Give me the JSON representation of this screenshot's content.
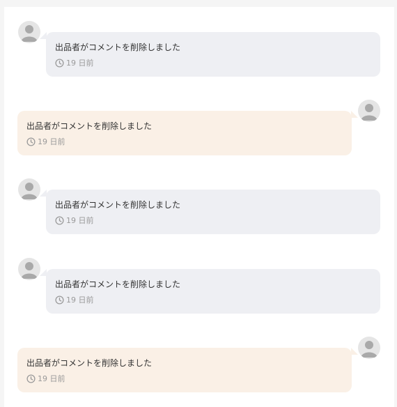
{
  "comments": [
    {
      "side": "left",
      "text": "出品者がコメントを削除しました",
      "time": "19 日前",
      "avatar_icon": "user-avatar-icon"
    },
    {
      "side": "right",
      "text": "出品者がコメントを削除しました",
      "time": "19 日前",
      "avatar_icon": "user-avatar-icon"
    },
    {
      "side": "left",
      "text": "出品者がコメントを削除しました",
      "time": "19 日前",
      "avatar_icon": "user-avatar-icon"
    },
    {
      "side": "left",
      "text": "出品者がコメントを削除しました",
      "time": "19 日前",
      "avatar_icon": "user-avatar-icon"
    },
    {
      "side": "right",
      "text": "出品者がコメントを削除しました",
      "time": "19 日前",
      "avatar_icon": "user-avatar-icon"
    }
  ],
  "colors": {
    "left_bubble": "#eeeff3",
    "right_bubble": "#faf0e6",
    "avatar_bg": "#e5e5e5",
    "avatar_figure": "#a9a9a9",
    "time_text": "#9a9a9a"
  }
}
